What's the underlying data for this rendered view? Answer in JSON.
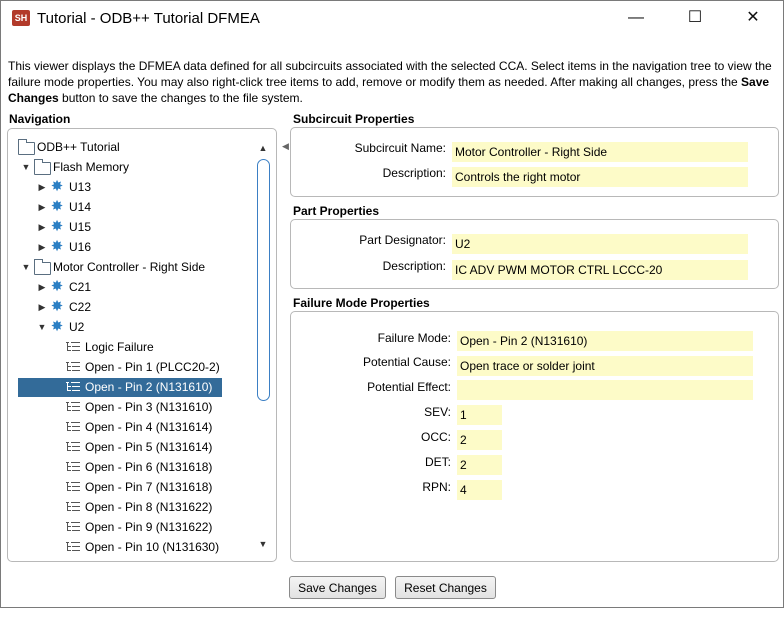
{
  "window": {
    "app_icon_text": "SH",
    "title": "Tutorial - ODB++ Tutorial DFMEA",
    "minimize_glyph": "—",
    "maximize_glyph": "☐",
    "close_glyph": "✕"
  },
  "description": {
    "text_before_bold": "This viewer displays the DFMEA data defined for all subcircuits associated with the selected CCA. Select items in the navigation tree to view the failure mode properties. You may also right-click tree items to add, remove or modify them as needed. After making all changes, press the ",
    "bold_text": "Save Changes",
    "text_after_bold": " button to save the changes to the file system."
  },
  "navigation": {
    "heading": "Navigation",
    "tree": [
      {
        "label": "ODB++ Tutorial",
        "icon": "folder-icon",
        "arrow": ""
      },
      {
        "label": "Flash Memory",
        "icon": "folder-icon",
        "arrow": "▼"
      },
      {
        "label": "U13",
        "icon": "gear-icon",
        "arrow": "▶"
      },
      {
        "label": "U14",
        "icon": "gear-icon",
        "arrow": "▶"
      },
      {
        "label": "U15",
        "icon": "gear-icon",
        "arrow": "▶"
      },
      {
        "label": "U16",
        "icon": "gear-icon",
        "arrow": "▶"
      },
      {
        "label": "Motor Controller - Right Side",
        "icon": "folder-icon",
        "arrow": "▼"
      },
      {
        "label": "C21",
        "icon": "gear-icon",
        "arrow": "▶"
      },
      {
        "label": "C22",
        "icon": "gear-icon",
        "arrow": "▶"
      },
      {
        "label": "U2",
        "icon": "gear-icon",
        "arrow": "▼"
      },
      {
        "label": "Logic Failure",
        "icon": "list-icon",
        "arrow": ""
      },
      {
        "label": "Open - Pin 1 (PLCC20-2)",
        "icon": "list-icon",
        "arrow": ""
      },
      {
        "label": "Open - Pin 2 (N131610)",
        "icon": "list-icon",
        "arrow": "",
        "selected": true
      },
      {
        "label": "Open - Pin 3 (N131610)",
        "icon": "list-icon",
        "arrow": ""
      },
      {
        "label": "Open - Pin 4 (N131614)",
        "icon": "list-icon",
        "arrow": ""
      },
      {
        "label": "Open - Pin 5 (N131614)",
        "icon": "list-icon",
        "arrow": ""
      },
      {
        "label": "Open - Pin 6 (N131618)",
        "icon": "list-icon",
        "arrow": ""
      },
      {
        "label": "Open - Pin 7 (N131618)",
        "icon": "list-icon",
        "arrow": ""
      },
      {
        "label": "Open - Pin 8 (N131622)",
        "icon": "list-icon",
        "arrow": ""
      },
      {
        "label": "Open - Pin 9 (N131622)",
        "icon": "list-icon",
        "arrow": ""
      },
      {
        "label": "Open - Pin 10 (N131630)",
        "icon": "list-icon",
        "arrow": ""
      }
    ],
    "selected_color": "#336b99"
  },
  "subcircuit": {
    "heading": "Subcircuit Properties",
    "name_label": "Subcircuit Name:",
    "name_value": "Motor Controller - Right Side",
    "description_label": "Description:",
    "description_value": "Controls the right motor"
  },
  "part": {
    "heading": "Part Properties",
    "designator_label": "Part Designator:",
    "designator_value": "U2",
    "description_label": "Description:",
    "description_value": "IC ADV PWM MOTOR CTRL LCCC-20"
  },
  "failure_mode": {
    "heading": "Failure Mode Properties",
    "mode_label": "Failure Mode:",
    "mode_value": "Open - Pin 2 (N131610)",
    "cause_label": "Potential Cause:",
    "cause_value": "Open trace or solder joint",
    "effect_label": "Potential Effect:",
    "effect_value": "",
    "sev_label": "SEV:",
    "sev_value": "1",
    "occ_label": "OCC:",
    "occ_value": "2",
    "det_label": "DET:",
    "det_value": "2",
    "rpn_label": "RPN:",
    "rpn_value": "4"
  },
  "buttons": {
    "save_label": "Save Changes",
    "reset_label": "Reset Changes"
  },
  "colors": {
    "field_background": "#fdfbc8",
    "scroll_thumb": "#3b7fc4"
  }
}
